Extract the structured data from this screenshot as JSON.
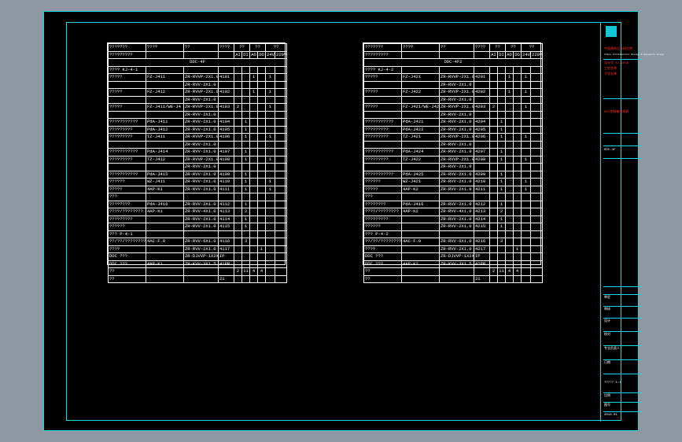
{
  "title_block": {
    "company": "中国建筑设计研究院",
    "company_en": "China Architecture Design & Research Group",
    "lines": [
      "设计号 SJ-2018",
      "工程名称",
      "子项名称",
      "DDC控制箱接线表",
      "审定",
      "审核",
      "设计",
      "校对",
      "专业负责人",
      "日期",
      "比例",
      "图号"
    ],
    "sheet_label": "DDC-4F",
    "drawing_no": "????? 1:1",
    "date": "2018.01"
  },
  "tables": [
    {
      "id": "left",
      "header": [
        "???????",
        "????",
        "??",
        "????",
        "??",
        "??",
        "??"
      ],
      "subheader": [
        "?????????",
        "",
        "",
        "",
        "AI",
        "DI",
        "AO",
        "DO",
        "24V",
        "220V"
      ],
      "panel_title": "DDC-4F",
      "rows": [
        [
          "????  KJ-4-1",
          "",
          "",
          "",
          "",
          "",
          "",
          "",
          "",
          ""
        ],
        [
          "?????",
          "FZ-J411",
          "ZR-RVVP-2X1.0",
          "4101",
          "",
          "",
          "1",
          "",
          "1",
          ""
        ],
        [
          "",
          "",
          "ZR-RVV-2X1.0",
          "",
          "",
          "",
          "",
          "",
          "",
          ""
        ],
        [
          "?????",
          "FZ-J412",
          "ZR-RVVP-2X1.0",
          "4102",
          "",
          "",
          "1",
          "",
          "1",
          ""
        ],
        [
          "",
          "",
          "ZR-RVV-2X1.0",
          "",
          "",
          "",
          "",
          "",
          "",
          ""
        ],
        [
          "?????",
          "FZ-J411/WE-J4",
          "ZR-RVVP-2X1.0",
          "4103",
          "2",
          "",
          "",
          "",
          "1",
          ""
        ],
        [
          "",
          "",
          "ZR-RVV-2X1.0",
          "",
          "",
          "",
          "",
          "",
          "",
          ""
        ],
        [
          "???????????",
          "PdA-J411",
          "ZR-RVV-2X1.0",
          "4104",
          "",
          "1",
          "",
          "",
          "",
          ""
        ],
        [
          "?????????",
          "PdA-J412",
          "ZR-RVV-2X1.0",
          "4105",
          "",
          "1",
          "",
          "",
          "",
          ""
        ],
        [
          "?????????",
          "TZ-J411",
          "ZR-RVVP-2X1.0",
          "4106",
          "",
          "1",
          "",
          "",
          "1",
          ""
        ],
        [
          "",
          "",
          "ZR-RVV-2X1.0",
          "",
          "",
          "",
          "",
          "",
          "",
          ""
        ],
        [
          "???????????",
          "PdA-J414",
          "ZR-RVV-2X1.0",
          "4107",
          "",
          "1",
          "",
          "",
          "",
          ""
        ],
        [
          "?????????",
          "TZ-J412",
          "ZR-RVVP-2X1.0",
          "4108",
          "",
          "1",
          "",
          "",
          "1",
          ""
        ],
        [
          "",
          "",
          "ZR-RVV-2X1.0",
          "",
          "",
          "",
          "",
          "",
          "",
          ""
        ],
        [
          "???????????",
          "PdA-J415",
          "ZR-RVV-2X1.0",
          "4109",
          "",
          "1",
          "",
          "",
          "",
          ""
        ],
        [
          "??????",
          "WZ-J411",
          "ZR-RVV-2X1.0",
          "4110",
          "",
          "1",
          "",
          "",
          "1",
          ""
        ],
        [
          "?????",
          "4AP-K1",
          "ZR-RVV-2X1.0",
          "4111",
          "",
          "1",
          "",
          "",
          "1",
          ""
        ],
        [
          "???",
          "",
          "",
          "",
          "",
          "",
          "",
          "",
          "",
          ""
        ],
        [
          "????????",
          "PdA-J416",
          "ZR-RVV-2X1.0",
          "4112",
          "",
          "1",
          "",
          "",
          "",
          ""
        ],
        [
          "????/????????",
          "4AP-K1",
          "ZR-RVV-4X1.0",
          "4113",
          "",
          "2",
          "",
          "",
          "",
          ""
        ],
        [
          "?????????",
          "",
          "ZR-RVV-2X1.0",
          "4114",
          "",
          "1",
          "",
          "",
          "",
          ""
        ],
        [
          "??????",
          "",
          "ZR-RVV-2X1.0",
          "4115",
          "",
          "1",
          "",
          "",
          "",
          ""
        ],
        [
          "???  P-4-1",
          "",
          "",
          "",
          "",
          "",
          "",
          "",
          "",
          ""
        ],
        [
          "??/??/????????",
          "4AC-F.0",
          "ZR-RVV-6X1.0",
          "4116",
          "",
          "3",
          "",
          "",
          "",
          ""
        ],
        [
          "????",
          "",
          "ZR-RVV-2X1.0",
          "4117",
          "",
          "",
          "",
          "1",
          "",
          ""
        ],
        [
          "DDC ???",
          "",
          "ZR-DJVVP-1X2X1.0",
          "IP",
          "",
          "",
          "",
          "",
          "",
          ""
        ],
        [
          "DDC ???",
          "4AP-K1",
          "ZR-KVV-3X1.5",
          "41PR",
          "",
          "",
          "",
          "",
          "",
          ""
        ],
        [
          "??",
          "",
          "",
          "",
          "2",
          "11",
          "4",
          "4",
          "",
          ""
        ],
        [
          "??",
          "",
          "",
          "21",
          "",
          "",
          "",
          "",
          "",
          ""
        ]
      ]
    },
    {
      "id": "right",
      "header": [
        "???????",
        "????",
        "??",
        "????",
        "??",
        "??",
        "??"
      ],
      "subheader": [
        "?????????",
        "",
        "",
        "",
        "AI",
        "DI",
        "AO",
        "DO",
        "24V",
        "220V"
      ],
      "panel_title": "DDC-4F2",
      "rows": [
        [
          "????  KJ-4-2",
          "",
          "",
          "",
          "",
          "",
          "",
          "",
          "",
          ""
        ],
        [
          "?????",
          "FZ-J421",
          "ZR-RVVP-2X1.0",
          "4201",
          "",
          "",
          "1",
          "",
          "1",
          ""
        ],
        [
          "",
          "",
          "ZR-RVV-2X1.0",
          "",
          "",
          "",
          "",
          "",
          "",
          ""
        ],
        [
          "?????",
          "FZ-J422",
          "ZR-RVVP-2X1.0",
          "4202",
          "",
          "",
          "1",
          "",
          "1",
          ""
        ],
        [
          "",
          "",
          "ZR-RVV-2X1.0",
          "",
          "",
          "",
          "",
          "",
          "",
          ""
        ],
        [
          "?????",
          "FZ-J421/WE-J42",
          "ZR-RVVP-2X1.0",
          "4203",
          "2",
          "",
          "",
          "",
          "1",
          ""
        ],
        [
          "",
          "",
          "ZR-RVV-2X1.0",
          "",
          "",
          "",
          "",
          "",
          "",
          ""
        ],
        [
          "???????????",
          "PdA-J421",
          "ZR-RVV-2X1.0",
          "4204",
          "",
          "1",
          "",
          "",
          "",
          ""
        ],
        [
          "?????????",
          "PdA-J422",
          "ZR-RVV-2X1.0",
          "4205",
          "",
          "1",
          "",
          "",
          "",
          ""
        ],
        [
          "?????????",
          "TZ-J421",
          "ZR-RVVP-2X1.0",
          "4206",
          "",
          "1",
          "",
          "",
          "1",
          ""
        ],
        [
          "",
          "",
          "ZR-RVV-2X1.0",
          "",
          "",
          "",
          "",
          "",
          "",
          ""
        ],
        [
          "???????????",
          "PdA-J424",
          "ZR-RVV-2X1.0",
          "4207",
          "",
          "1",
          "",
          "",
          "",
          ""
        ],
        [
          "?????????",
          "TZ-J422",
          "ZR-RVVP-2X1.0",
          "4208",
          "",
          "1",
          "",
          "",
          "1",
          ""
        ],
        [
          "",
          "",
          "ZR-RVV-2X1.0",
          "",
          "",
          "",
          "",
          "",
          "",
          ""
        ],
        [
          "???????????",
          "PdA-J425",
          "ZR-RVV-2X1.0",
          "4209",
          "",
          "1",
          "",
          "",
          "",
          ""
        ],
        [
          "??????",
          "WZ-J421",
          "ZR-RVV-2X1.0",
          "4210",
          "",
          "1",
          "",
          "",
          "1",
          ""
        ],
        [
          "?????",
          "4AP-K2",
          "ZR-RVV-2X1.0",
          "4211",
          "",
          "1",
          "",
          "",
          "1",
          ""
        ],
        [
          "???",
          "",
          "",
          "",
          "",
          "",
          "",
          "",
          "",
          ""
        ],
        [
          "????????",
          "PdA-J416",
          "ZR-RVV-2X1.0",
          "4212",
          "",
          "1",
          "",
          "",
          "",
          ""
        ],
        [
          "????/????????",
          "4AP-K2",
          "ZR-RVV-4X1.0",
          "4213",
          "",
          "2",
          "",
          "",
          "",
          ""
        ],
        [
          "?????????",
          "",
          "ZR-RVV-2X1.0",
          "4214",
          "",
          "1",
          "",
          "",
          "",
          ""
        ],
        [
          "??????",
          "",
          "ZR-RVV-2X1.0",
          "4215",
          "",
          "1",
          "",
          "",
          "",
          ""
        ],
        [
          "???  P-4-2",
          "",
          "",
          "",
          "",
          "",
          "",
          "",
          "",
          ""
        ],
        [
          "??/??/????????",
          "4AC-F.0",
          "ZR-RVV-6X1.0",
          "4216",
          "",
          "3",
          "",
          "",
          "",
          ""
        ],
        [
          "????",
          "",
          "ZR-RVV-2X1.0",
          "4217",
          "",
          "",
          "",
          "1",
          "",
          ""
        ],
        [
          "DDC ???",
          "",
          "ZR-DJVVP-1X2X1.0",
          "IP",
          "",
          "",
          "",
          "",
          "",
          ""
        ],
        [
          "DDC ???",
          "4AP-K2",
          "ZR-KVV-3X1.5",
          "42PR",
          "",
          "",
          "",
          "",
          "",
          ""
        ],
        [
          "??",
          "",
          "",
          "",
          "2",
          "11",
          "4",
          "4",
          "",
          ""
        ],
        [
          "??",
          "",
          "",
          "21",
          "",
          "",
          "",
          "",
          "",
          ""
        ]
      ]
    }
  ]
}
